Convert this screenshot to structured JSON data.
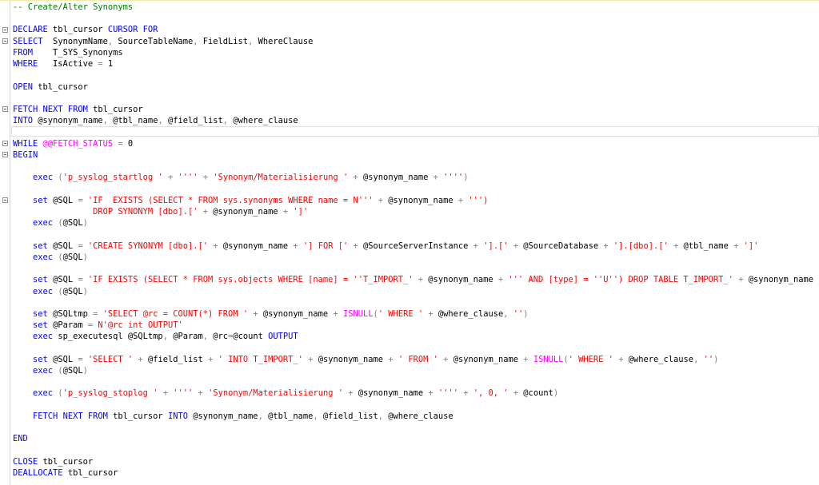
{
  "editor": {
    "current_line": 12,
    "fold_lines": [
      3,
      4,
      10,
      13,
      14,
      18
    ],
    "colors": {
      "keyword": "#0000ff",
      "string": "#ff0000",
      "comment": "#008000",
      "system_function": "#ff00ff",
      "operator": "#808080"
    },
    "lines": [
      [
        [
          "cmt",
          "-- Create/Alter Synonyms"
        ]
      ],
      [],
      [
        [
          "kw",
          "DECLARE"
        ],
        [
          "p",
          " tbl_cursor "
        ],
        [
          "kw",
          "CURSOR FOR"
        ]
      ],
      [
        [
          "kw",
          "SELECT"
        ],
        [
          "p",
          "  SynonymName"
        ],
        [
          "op",
          ","
        ],
        [
          "p",
          " SourceTableName"
        ],
        [
          "op",
          ","
        ],
        [
          "p",
          " FieldList"
        ],
        [
          "op",
          ","
        ],
        [
          "p",
          " WhereClause"
        ]
      ],
      [
        [
          "kw",
          "FROM"
        ],
        [
          "p",
          "    T_SYS_Synonyms"
        ]
      ],
      [
        [
          "kw",
          "WHERE"
        ],
        [
          "p",
          "   IsActive "
        ],
        [
          "op",
          "="
        ],
        [
          "p",
          " 1"
        ]
      ],
      [],
      [
        [
          "kw",
          "OPEN"
        ],
        [
          "p",
          " tbl_cursor"
        ]
      ],
      [],
      [
        [
          "kw",
          "FETCH NEXT FROM"
        ],
        [
          "p",
          " tbl_cursor"
        ]
      ],
      [
        [
          "kw",
          "INTO"
        ],
        [
          "p",
          " @synonym_name"
        ],
        [
          "op",
          ","
        ],
        [
          "p",
          " @tbl_name"
        ],
        [
          "op",
          ","
        ],
        [
          "p",
          " @field_list"
        ],
        [
          "op",
          ","
        ],
        [
          "p",
          " @where_clause"
        ]
      ],
      [],
      [
        [
          "kw",
          "WHILE"
        ],
        [
          "p",
          " "
        ],
        [
          "sys",
          "@@FETCH_STATUS"
        ],
        [
          "p",
          " "
        ],
        [
          "op",
          "="
        ],
        [
          "p",
          " 0"
        ]
      ],
      [
        [
          "kw",
          "BEGIN"
        ]
      ],
      [],
      [
        [
          "p",
          "    "
        ],
        [
          "kw",
          "exec"
        ],
        [
          "p",
          " "
        ],
        [
          "op",
          "("
        ],
        [
          "str",
          "'p_syslog_startlog '"
        ],
        [
          "p",
          " "
        ],
        [
          "op",
          "+"
        ],
        [
          "p",
          " "
        ],
        [
          "str",
          "''''"
        ],
        [
          "p",
          " "
        ],
        [
          "op",
          "+"
        ],
        [
          "p",
          " "
        ],
        [
          "str",
          "'Synonym/Materialisierung '"
        ],
        [
          "p",
          " "
        ],
        [
          "op",
          "+"
        ],
        [
          "p",
          " @synonym_name "
        ],
        [
          "op",
          "+"
        ],
        [
          "p",
          " "
        ],
        [
          "str",
          "''''"
        ],
        [
          "op",
          ")"
        ]
      ],
      [],
      [
        [
          "p",
          "    "
        ],
        [
          "kw",
          "set"
        ],
        [
          "p",
          " @SQL "
        ],
        [
          "op",
          "="
        ],
        [
          "p",
          " "
        ],
        [
          "str",
          "'IF  EXISTS (SELECT * FROM sys.synonyms WHERE name = N'''"
        ],
        [
          "p",
          " "
        ],
        [
          "op",
          "+"
        ],
        [
          "p",
          " @synonym_name "
        ],
        [
          "op",
          "+"
        ],
        [
          "p",
          " "
        ],
        [
          "str",
          "''')"
        ]
      ],
      [
        [
          "p",
          "                "
        ],
        [
          "str",
          "DROP SYNONYM [dbo].['"
        ],
        [
          "p",
          " "
        ],
        [
          "op",
          "+"
        ],
        [
          "p",
          " @synonym_name "
        ],
        [
          "op",
          "+"
        ],
        [
          "p",
          " "
        ],
        [
          "str",
          "']'"
        ]
      ],
      [
        [
          "p",
          "    "
        ],
        [
          "kw",
          "exec"
        ],
        [
          "p",
          " "
        ],
        [
          "op",
          "("
        ],
        [
          "p",
          "@SQL"
        ],
        [
          "op",
          ")"
        ]
      ],
      [],
      [
        [
          "p",
          "    "
        ],
        [
          "kw",
          "set"
        ],
        [
          "p",
          " @SQL "
        ],
        [
          "op",
          "="
        ],
        [
          "p",
          " "
        ],
        [
          "str",
          "'CREATE SYNONYM [dbo].['"
        ],
        [
          "p",
          " "
        ],
        [
          "op",
          "+"
        ],
        [
          "p",
          " @synonym_name "
        ],
        [
          "op",
          "+"
        ],
        [
          "p",
          " "
        ],
        [
          "str",
          "'] FOR ['"
        ],
        [
          "p",
          " "
        ],
        [
          "op",
          "+"
        ],
        [
          "p",
          " @SourceServerInstance "
        ],
        [
          "op",
          "+"
        ],
        [
          "p",
          " "
        ],
        [
          "str",
          "'].['"
        ],
        [
          "p",
          " "
        ],
        [
          "op",
          "+"
        ],
        [
          "p",
          " @SourceDatabase "
        ],
        [
          "op",
          "+"
        ],
        [
          "p",
          " "
        ],
        [
          "str",
          "'].[dbo].['"
        ],
        [
          "p",
          " "
        ],
        [
          "op",
          "+"
        ],
        [
          "p",
          " @tbl_name "
        ],
        [
          "op",
          "+"
        ],
        [
          "p",
          " "
        ],
        [
          "str",
          "']'"
        ]
      ],
      [
        [
          "p",
          "    "
        ],
        [
          "kw",
          "exec"
        ],
        [
          "p",
          " "
        ],
        [
          "op",
          "("
        ],
        [
          "p",
          "@SQL"
        ],
        [
          "op",
          ")"
        ]
      ],
      [],
      [
        [
          "p",
          "    "
        ],
        [
          "kw",
          "set"
        ],
        [
          "p",
          " @SQL "
        ],
        [
          "op",
          "="
        ],
        [
          "p",
          " "
        ],
        [
          "str",
          "'IF EXISTS (SELECT * FROM sys.objects WHERE [name] = ''T_IMPORT_'"
        ],
        [
          "p",
          " "
        ],
        [
          "op",
          "+"
        ],
        [
          "p",
          " @synonym_name "
        ],
        [
          "op",
          "+"
        ],
        [
          "p",
          " "
        ],
        [
          "str",
          "''' AND [type] = ''U'') DROP TABLE T_IMPORT_'"
        ],
        [
          "p",
          " "
        ],
        [
          "op",
          "+"
        ],
        [
          "p",
          " @synonym_name"
        ]
      ],
      [
        [
          "p",
          "    "
        ],
        [
          "kw",
          "exec"
        ],
        [
          "p",
          " "
        ],
        [
          "op",
          "("
        ],
        [
          "p",
          "@SQL"
        ],
        [
          "op",
          ")"
        ]
      ],
      [],
      [
        [
          "p",
          "    "
        ],
        [
          "kw",
          "set"
        ],
        [
          "p",
          " @SQLtmp "
        ],
        [
          "op",
          "="
        ],
        [
          "p",
          " "
        ],
        [
          "str",
          "'SELECT @rc = COUNT(*) FROM '"
        ],
        [
          "p",
          " "
        ],
        [
          "op",
          "+"
        ],
        [
          "p",
          " @synonym_name "
        ],
        [
          "op",
          "+"
        ],
        [
          "p",
          " "
        ],
        [
          "sys",
          "ISNULL"
        ],
        [
          "op",
          "("
        ],
        [
          "str",
          "' WHERE '"
        ],
        [
          "p",
          " "
        ],
        [
          "op",
          "+"
        ],
        [
          "p",
          " @where_clause"
        ],
        [
          "op",
          ","
        ],
        [
          "p",
          " "
        ],
        [
          "str",
          "''"
        ],
        [
          "op",
          ")"
        ]
      ],
      [
        [
          "p",
          "    "
        ],
        [
          "kw",
          "set"
        ],
        [
          "p",
          " @Param "
        ],
        [
          "op",
          "="
        ],
        [
          "p",
          " "
        ],
        [
          "str",
          "N'@rc int OUTPUT'"
        ]
      ],
      [
        [
          "p",
          "    "
        ],
        [
          "kw",
          "exec"
        ],
        [
          "p",
          " sp_executesql @SQLtmp"
        ],
        [
          "op",
          ","
        ],
        [
          "p",
          " @Param"
        ],
        [
          "op",
          ","
        ],
        [
          "p",
          " @rc"
        ],
        [
          "op",
          "="
        ],
        [
          "p",
          "@count "
        ],
        [
          "kw",
          "OUTPUT"
        ]
      ],
      [],
      [
        [
          "p",
          "    "
        ],
        [
          "kw",
          "set"
        ],
        [
          "p",
          " @SQL "
        ],
        [
          "op",
          "="
        ],
        [
          "p",
          " "
        ],
        [
          "str",
          "'SELECT '"
        ],
        [
          "p",
          " "
        ],
        [
          "op",
          "+"
        ],
        [
          "p",
          " @field_list "
        ],
        [
          "op",
          "+"
        ],
        [
          "p",
          " "
        ],
        [
          "str",
          "' INTO T_IMPORT_'"
        ],
        [
          "p",
          " "
        ],
        [
          "op",
          "+"
        ],
        [
          "p",
          " @synonym_name "
        ],
        [
          "op",
          "+"
        ],
        [
          "p",
          " "
        ],
        [
          "str",
          "' FROM '"
        ],
        [
          "p",
          " "
        ],
        [
          "op",
          "+"
        ],
        [
          "p",
          " @synonym_name "
        ],
        [
          "op",
          "+"
        ],
        [
          "p",
          " "
        ],
        [
          "sys",
          "ISNULL"
        ],
        [
          "op",
          "("
        ],
        [
          "str",
          "' WHERE '"
        ],
        [
          "p",
          " "
        ],
        [
          "op",
          "+"
        ],
        [
          "p",
          " @where_clause"
        ],
        [
          "op",
          ","
        ],
        [
          "p",
          " "
        ],
        [
          "str",
          "''"
        ],
        [
          "op",
          ")"
        ]
      ],
      [
        [
          "p",
          "    "
        ],
        [
          "kw",
          "exec"
        ],
        [
          "p",
          " "
        ],
        [
          "op",
          "("
        ],
        [
          "p",
          "@SQL"
        ],
        [
          "op",
          ")"
        ]
      ],
      [],
      [
        [
          "p",
          "    "
        ],
        [
          "kw",
          "exec"
        ],
        [
          "p",
          " "
        ],
        [
          "op",
          "("
        ],
        [
          "str",
          "'p_syslog_stoplog '"
        ],
        [
          "p",
          " "
        ],
        [
          "op",
          "+"
        ],
        [
          "p",
          " "
        ],
        [
          "str",
          "''''"
        ],
        [
          "p",
          " "
        ],
        [
          "op",
          "+"
        ],
        [
          "p",
          " "
        ],
        [
          "str",
          "'Synonym/Materialisierung '"
        ],
        [
          "p",
          " "
        ],
        [
          "op",
          "+"
        ],
        [
          "p",
          " @synonym_name "
        ],
        [
          "op",
          "+"
        ],
        [
          "p",
          " "
        ],
        [
          "str",
          "''''"
        ],
        [
          "p",
          " "
        ],
        [
          "op",
          "+"
        ],
        [
          "p",
          " "
        ],
        [
          "str",
          "', 0, '"
        ],
        [
          "p",
          " "
        ],
        [
          "op",
          "+"
        ],
        [
          "p",
          " @count"
        ],
        [
          "op",
          ")"
        ]
      ],
      [],
      [
        [
          "p",
          "    "
        ],
        [
          "kw",
          "FETCH NEXT FROM"
        ],
        [
          "p",
          " tbl_cursor "
        ],
        [
          "kw",
          "INTO"
        ],
        [
          "p",
          " @synonym_name"
        ],
        [
          "op",
          ","
        ],
        [
          "p",
          " @tbl_name"
        ],
        [
          "op",
          ","
        ],
        [
          "p",
          " @field_list"
        ],
        [
          "op",
          ","
        ],
        [
          "p",
          " @where_clause"
        ]
      ],
      [],
      [
        [
          "kw",
          "END"
        ]
      ],
      [],
      [
        [
          "kw",
          "CLOSE"
        ],
        [
          "p",
          " tbl_cursor"
        ]
      ],
      [
        [
          "kw",
          "DEALLOCATE"
        ],
        [
          "p",
          " tbl_cursor"
        ]
      ]
    ]
  }
}
